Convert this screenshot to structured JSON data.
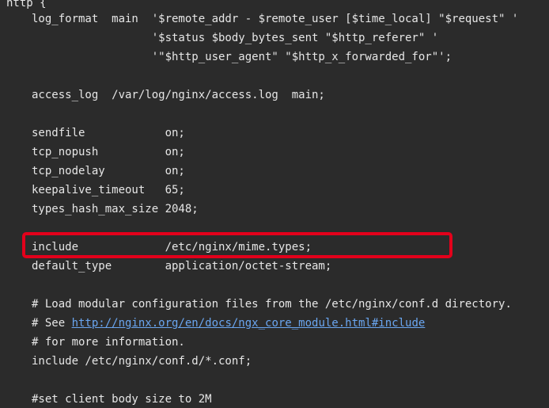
{
  "editor": {
    "lines": [
      {
        "text": "http {"
      },
      {
        "text": "log_format  main  '$remote_addr - $remote_user [$time_local] \"$request\" '"
      },
      {
        "text": "                  '$status $body_bytes_sent \"$http_referer\" '"
      },
      {
        "text": "                  '\"$http_user_agent\" \"$http_x_forwarded_for\"';"
      },
      {
        "text": "access_log  /var/log/nginx/access.log  main;"
      },
      {
        "text": "sendfile            on;"
      },
      {
        "text": "tcp_nopush          on;"
      },
      {
        "text": "tcp_nodelay         on;"
      },
      {
        "text": "keepalive_timeout   65;"
      },
      {
        "text": "types_hash_max_size 2048;"
      },
      {
        "text": "include             /etc/nginx/mime.types;"
      },
      {
        "text": "default_type        application/octet-stream;"
      },
      {
        "text": "# Load modular configuration files from the /etc/nginx/conf.d directory."
      },
      {
        "prefix": "# See ",
        "link": "http://nginx.org/en/docs/ngx_core_module.html#include"
      },
      {
        "text": "# for more information."
      },
      {
        "text": "include /etc/nginx/conf.d/*.conf;"
      },
      {
        "text": "#set client body size to 2M"
      }
    ],
    "highlight_color": "#e3001b",
    "link_color": "#6aa6f0",
    "background_color": "#2b2b2b"
  }
}
